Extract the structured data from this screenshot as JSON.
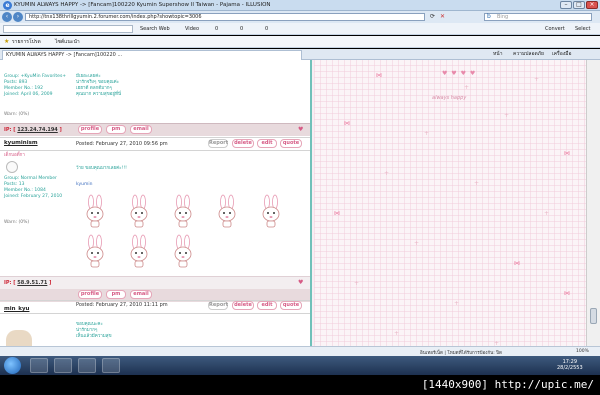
{
  "window": {
    "title": "KYUMIN ALWAYS HAPPY -> [Fancam]100220 Kyumin Supershow II Taiwan - Pajama - ILLUSION",
    "url": "http://tnx138thrillgyumin.2.forumer.com/index.php?showtopic=3006",
    "search_placeholder": "Bing",
    "search_label": "Search Web",
    "video_label": "Video",
    "count_a": "0",
    "count_b": "0",
    "count_c": "0",
    "convert_label": "Convert",
    "select_label": "Select",
    "favorites_label": "รายการโปรด",
    "suggested_label": "ไซต์แนะนำ",
    "tab_title": "KYUMIN ALWAYS HAPPY -> [Fancam]100220 ...",
    "page_menu": "หน้า",
    "safety_menu": "ความปลอดภัย",
    "tools_menu": "เครื่องมือ"
  },
  "posts": [
    {
      "meta": [
        "Group: +KyuMin Favorites+",
        "Posts: 893",
        "Member No.: 192",
        "Joined: April 06, 2009"
      ],
      "warn": "Warn: (0%)",
      "body": [
        "มีเยอะเลยค่ะ",
        "น่ารักจริงๆ ขอบคุณค่ะ",
        "เฮฮาดี ตลกดีมากๆ",
        "คุณมาก ความสุขอยู่ที่นี่"
      ],
      "ip": "123.24.74.194"
    },
    {
      "author": "kyuminism",
      "posted": "Posted: February 27, 2010 09:56 pm",
      "rank": "เด็กบอดี้กา",
      "meta": [
        "Group: Normal Member",
        "Posts: 13",
        "Member No.: 1084",
        "Joined: February 27, 2010"
      ],
      "warn": "Warn: (0%)",
      "body": [
        "ว้าย ขอบคุณมากเลยค่ะ!!!",
        "kyumin"
      ],
      "ip": "58.9.51.71"
    },
    {
      "author": "min_kyu",
      "posted": "Posted: February 27, 2010 11:11 pm",
      "body": [
        "ขอบคุณนะคะ",
        "น่ารักมากๆ",
        "เห็นแล้วมีความสุข"
      ]
    }
  ],
  "buttons": {
    "profile": "profile",
    "pm": "pm",
    "email": "email",
    "report": "Report",
    "delete": "delete",
    "edit": "edit",
    "quote": "quote"
  },
  "wallpaper_text": "always happy",
  "status_text": "อินเทอร์เน็ต | โหมดที่ได้รับการป้องกัน: ปิด",
  "zoom": "100%",
  "clock": {
    "time": "17:29",
    "date": "28/2/2553"
  },
  "caption": "[1440x900] http://upic.me/"
}
